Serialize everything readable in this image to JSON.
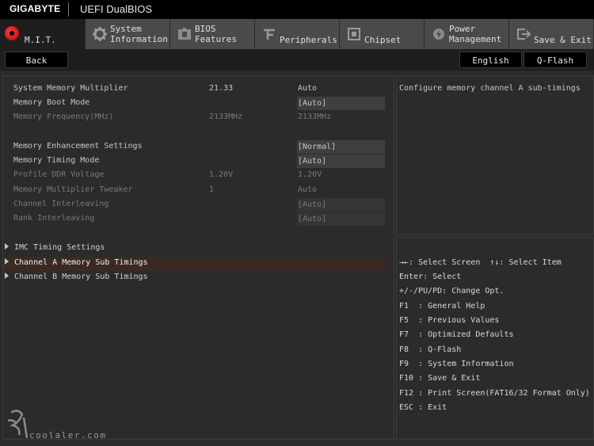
{
  "header": {
    "brand": "GIGABYTE",
    "product": "UEFI DualBIOS"
  },
  "tabs": [
    {
      "label": "M.I.T.",
      "icon": "mit-icon"
    },
    {
      "label": "System\nInformation",
      "icon": "gear-icon"
    },
    {
      "label": "BIOS\nFeatures",
      "icon": "bios-features-icon"
    },
    {
      "label": "Peripherals",
      "icon": "peripherals-icon"
    },
    {
      "label": "Chipset",
      "icon": "chipset-icon"
    },
    {
      "label": "Power\nManagement",
      "icon": "power-icon"
    },
    {
      "label": "Save & Exit",
      "icon": "exit-icon"
    }
  ],
  "subbar": {
    "back": "Back",
    "language": "English",
    "qflash": "Q-Flash"
  },
  "settings": [
    {
      "label": "System Memory Multiplier",
      "value": "21.33",
      "option": "Auto",
      "enabled": true,
      "boxed": false
    },
    {
      "label": "Memory Boot Mode",
      "value": "",
      "option": "[Auto]",
      "enabled": true,
      "boxed": true
    },
    {
      "label": "Memory Frequency(MHz)",
      "value": "2133MHz",
      "option": "2133MHz",
      "enabled": false,
      "boxed": false
    },
    {
      "label": "Memory Enhancement Settings",
      "value": "",
      "option": "[Normal]",
      "enabled": true,
      "boxed": true
    },
    {
      "label": "Memory Timing Mode",
      "value": "",
      "option": "[Auto]",
      "enabled": true,
      "boxed": true
    },
    {
      "label": "Profile DDR Voltage",
      "value": "1.20V",
      "option": "1.20V",
      "enabled": false,
      "boxed": false
    },
    {
      "label": "Memory Multiplier Tweaker",
      "value": "1",
      "option": "Auto",
      "enabled": false,
      "boxed": false
    },
    {
      "label": "Channel Interleaving",
      "value": "",
      "option": "[Auto]",
      "enabled": false,
      "boxed": true
    },
    {
      "label": "Rank Interleaving",
      "value": "",
      "option": "[Auto]",
      "enabled": false,
      "boxed": true
    }
  ],
  "submenus": [
    {
      "label": "IMC Timing Settings"
    },
    {
      "label": "Channel A Memory Sub Timings"
    },
    {
      "label": "Channel B Memory Sub Timings"
    }
  ],
  "help": {
    "description": "Configure memory channel A sub-timings"
  },
  "keys": [
    "→←: Select Screen  ↑↓: Select Item",
    "Enter: Select",
    "+/-/PU/PD: Change Opt.",
    "F1  : General Help",
    "F5  : Previous Values",
    "F7  : Optimized Defaults",
    "F8  : Q-Flash",
    "F9  : System Information",
    "F10 : Save & Exit",
    "F12 : Print Screen(FAT16/32 Format Only)",
    "ESC : Exit"
  ],
  "watermark": {
    "text": "coolaler.com"
  },
  "colors": {
    "active_tab": "#1e1e1e",
    "highlight": "#3b2a22",
    "mit_dot": "#e01010"
  }
}
